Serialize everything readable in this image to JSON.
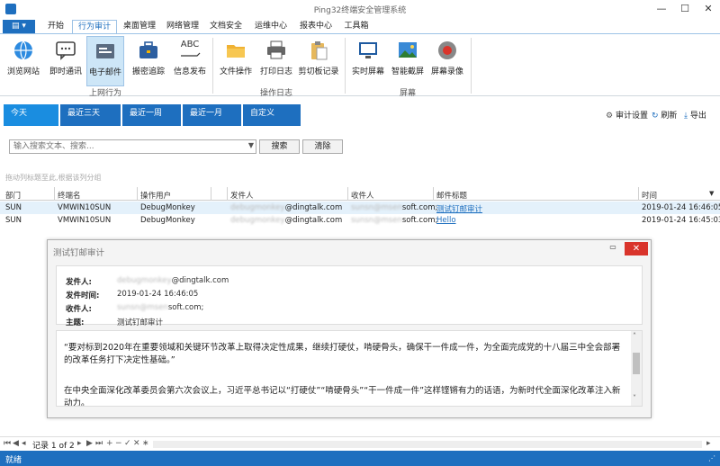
{
  "window": {
    "title": "Ping32终端安全管理系统",
    "minimize": "—",
    "maximize": "☐",
    "close": "✕"
  },
  "appmenu": {
    "label": "▤ ▾"
  },
  "ribbon_tabs": [
    "开始",
    "行为审计",
    "桌面管理",
    "网络管理",
    "文档安全",
    "运维中心",
    "报表中心",
    "工具箱"
  ],
  "ribbon": {
    "groups": [
      {
        "label": "上网行为",
        "items": [
          "浏览网站",
          "即时通讯",
          "电子邮件",
          "搬密追踪",
          "信息发布"
        ]
      },
      {
        "label": "操作日志",
        "items": [
          "文件操作",
          "打印日志",
          "剪切板记录"
        ]
      },
      {
        "label": "屏幕",
        "items": [
          "实时屏幕",
          "智能截屏",
          "屏幕录像"
        ]
      }
    ],
    "abc_glyph": "ABC"
  },
  "date_tabs": [
    "今天",
    "最近三天",
    "最近一周",
    "最近一月",
    "自定义"
  ],
  "actions": {
    "audit_settings": "审计设置",
    "refresh": "刷新",
    "export": "导出"
  },
  "search": {
    "placeholder": "输入搜索文本、搜索...",
    "search_btn": "搜索",
    "clear_btn": "清除"
  },
  "group_hint": "拖动列标题至此,根据该列分组",
  "table": {
    "columns": [
      "部门",
      "终端名",
      "操作用户",
      "发件人",
      "收件人",
      "邮件标题",
      "时间"
    ],
    "rows": [
      {
        "dept": "SUN",
        "terminal": "VMWIN10SUN",
        "user": "DebugMonkey",
        "sender_hidden": "debugmonkey",
        "sender_domain": "@dingtalk.com",
        "recipient_hidden": "sunsn@msen",
        "recipient_domain": "soft.com;",
        "subject": "测试钉邮审计",
        "time": "2019-01-24 16:46:05"
      },
      {
        "dept": "SUN",
        "terminal": "VMWIN10SUN",
        "user": "DebugMonkey",
        "sender_hidden": "debugmonkey",
        "sender_domain": "@dingtalk.com",
        "recipient_hidden": "sunsn@msen",
        "recipient_domain": "soft.com;",
        "subject": "Hello",
        "time": "2019-01-24 16:45:03"
      }
    ]
  },
  "pager": {
    "text": "记录 1 of 2"
  },
  "status": {
    "text": "就绪"
  },
  "dialog": {
    "title": "测试钉邮审计",
    "fields": {
      "from_label": "发件人:",
      "from_hidden": "debugmonkey",
      "from_domain": "@dingtalk.com",
      "time_label": "发件时间:",
      "time_value": "2019-01-24 16:46:05",
      "to_label": "收件人:",
      "to_hidden": "sunsn@msen",
      "to_domain": "soft.com;",
      "subject_label": "主题:",
      "subject_value": "测试钉邮审计"
    },
    "body": [
      "“要对标到2020年在重要领域和关键环节改革上取得决定性成果，继续打硬仗，啃硬骨头，确保干一件成一件，为全面完成党的十八届三中全会部署的改革任务打下决定性基础。”",
      "在中央全面深化改革委员会第六次会议上，习近平总书记以“打硬仗”“啃硬骨头”“干一件成一件”这样铿锵有力的话语，为新时代全面深化改革注入新动力。"
    ]
  }
}
